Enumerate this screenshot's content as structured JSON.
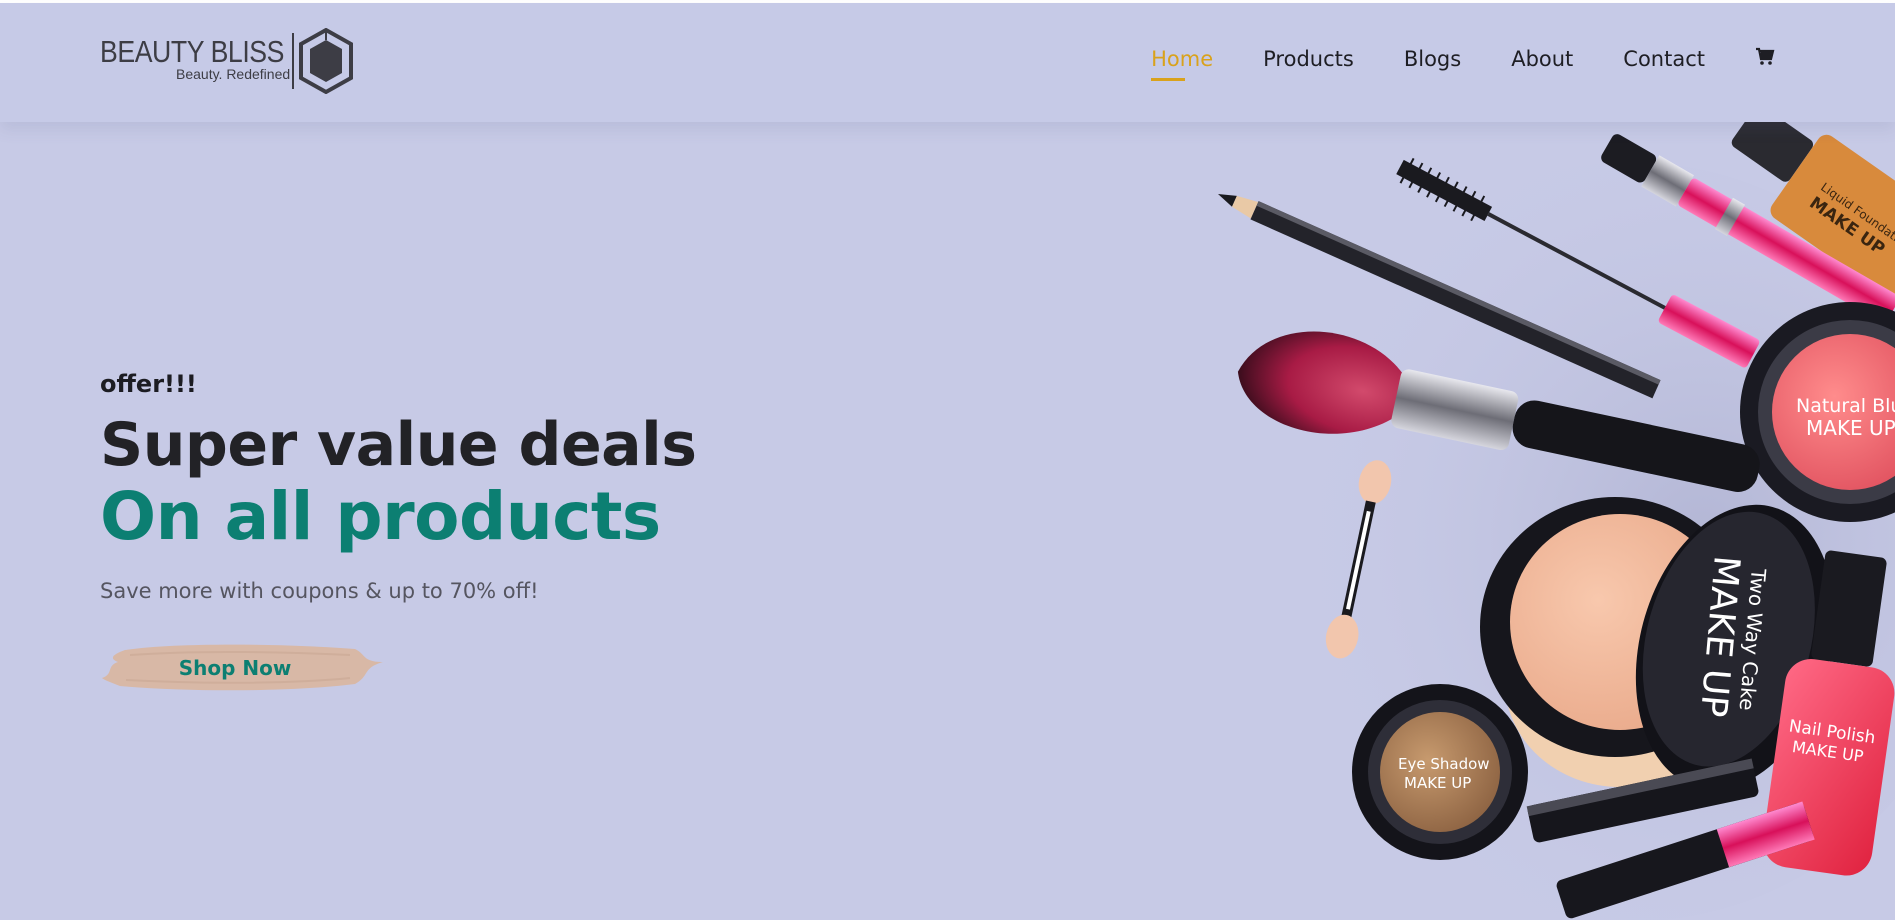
{
  "brand": {
    "name": "BEAUTY BLISS",
    "tagline": "Beauty. Redefined"
  },
  "nav": {
    "items": [
      {
        "label": "Home",
        "active": true
      },
      {
        "label": "Products",
        "active": false
      },
      {
        "label": "Blogs",
        "active": false
      },
      {
        "label": "About",
        "active": false
      },
      {
        "label": "Contact",
        "active": false
      }
    ],
    "cart_icon": "cart-icon"
  },
  "hero": {
    "kicker": "offer!!!",
    "headline": "Super value deals",
    "headline_accent": "On all products",
    "subtitle": "Save more with coupons & up to 70% off!",
    "cta_label": "Shop Now"
  },
  "product_labels": {
    "foundation": "Liquid Foundation",
    "foundation_brand": "MAKE UP",
    "blush": "Natural Blush",
    "blush_brand": "MAKE UP",
    "cake": "Two Way Cake",
    "cake_brand": "MAKE UP",
    "eyeshadow": "Eye Shadow",
    "eyeshadow_brand": "MAKE UP",
    "polish": "Nail Polish",
    "polish_brand": "MAKE UP"
  },
  "colors": {
    "background": "#c7cae6",
    "accent_active": "#d9a21c",
    "headline_accent": "#0c7f72",
    "cta_brush": "#d8b8a6"
  }
}
